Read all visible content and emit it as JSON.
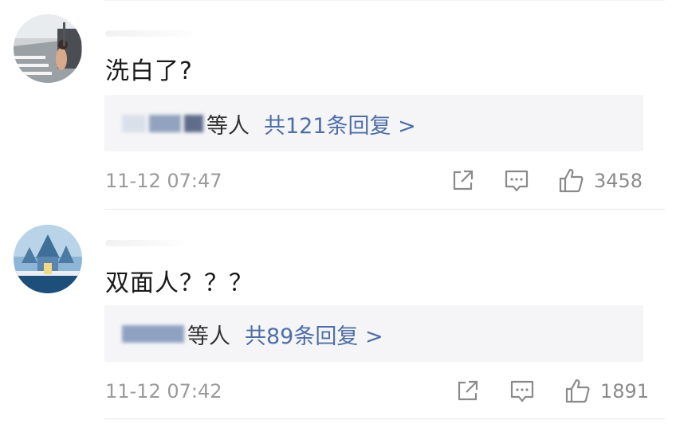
{
  "comments": [
    {
      "avatar_icon": "user-avatar-photo-street",
      "text": "洗白了?",
      "reply_suffix": "等人",
      "reply_count_label": "共121条回复 >",
      "timestamp": "11-12 07:47",
      "like_count": "3458"
    },
    {
      "avatar_icon": "user-avatar-photo-castle",
      "text": "双面人？？？",
      "reply_suffix": "等人",
      "reply_count_label": "共89条回复 >",
      "timestamp": "11-12 07:42",
      "like_count": "1891"
    }
  ],
  "icons": {
    "share": "share-icon",
    "comment": "comment-icon",
    "like": "thumbs-up-icon"
  },
  "colors": {
    "link": "#4e6ea6",
    "text": "#1a1a1a",
    "meta": "#9a9a9a",
    "reply_bg": "#f5f5f7"
  }
}
